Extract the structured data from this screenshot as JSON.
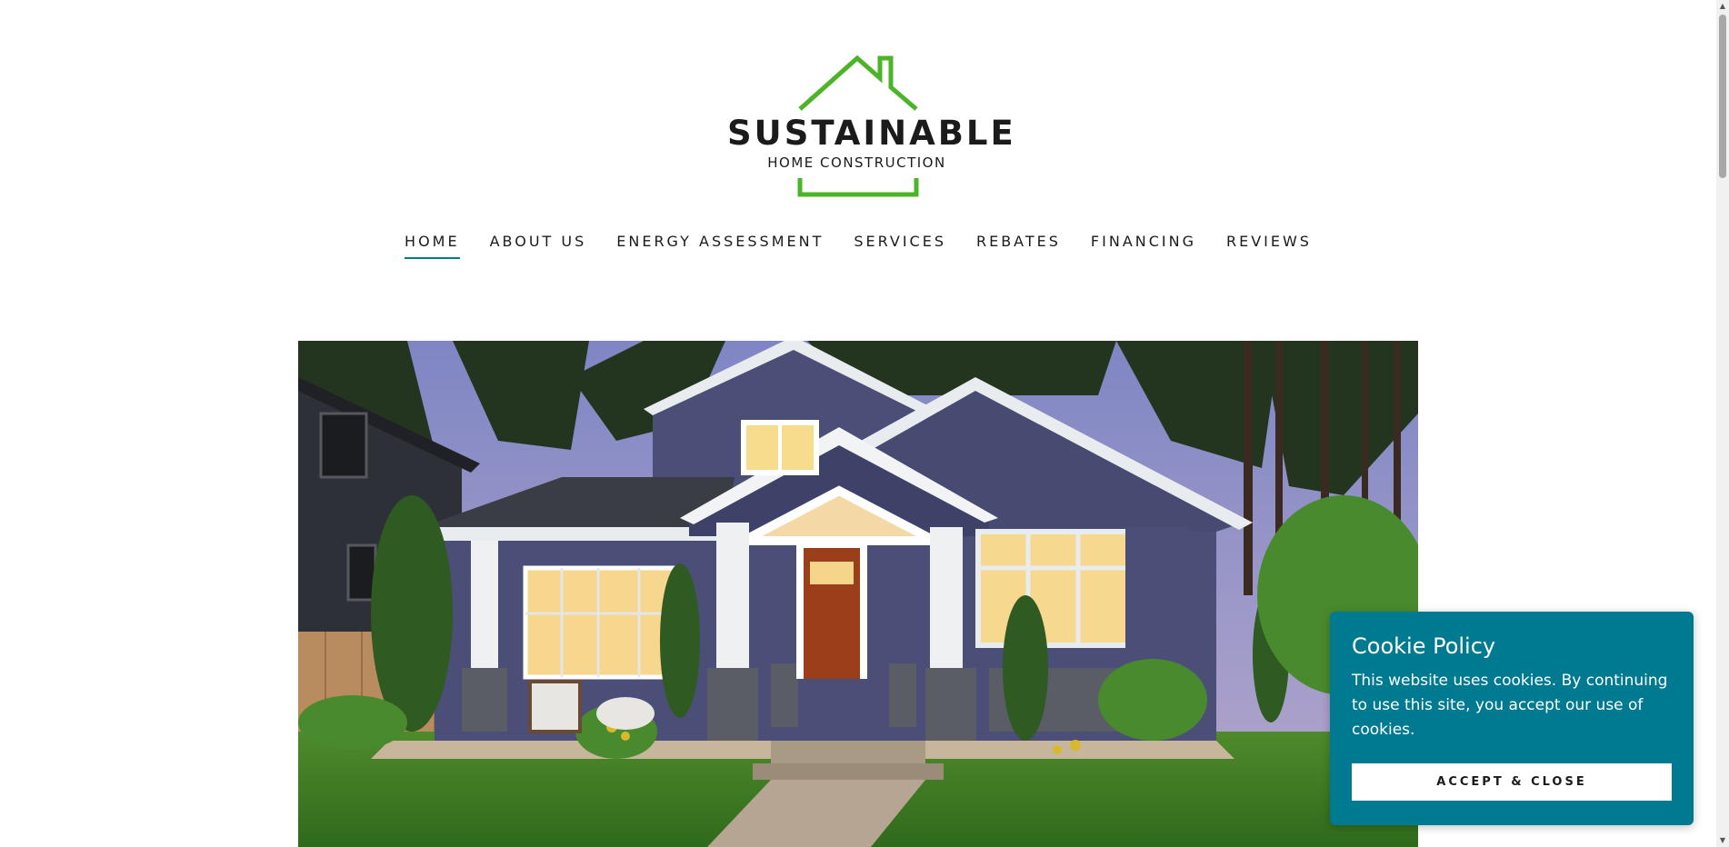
{
  "brand": {
    "name": "SUSTAINABLE",
    "tagline": "HOME CONSTRUCTION",
    "logo_icon": "house-outline-icon",
    "accent_color": "#4cb527"
  },
  "nav": {
    "items": [
      {
        "label": "HOME",
        "active": true
      },
      {
        "label": "ABOUT US",
        "active": false
      },
      {
        "label": "ENERGY ASSESSMENT",
        "active": false
      },
      {
        "label": "SERVICES",
        "active": false
      },
      {
        "label": "REBATES",
        "active": false
      },
      {
        "label": "FINANCING",
        "active": false
      },
      {
        "label": "REVIEWS",
        "active": false
      }
    ],
    "active_underline_color": "#007a91"
  },
  "hero": {
    "image_subject": "craftsman-house-photo"
  },
  "cookie_banner": {
    "title": "Cookie Policy",
    "text": "This website uses cookies. By continuing to use this site, you accept our use of cookies.",
    "button_label": "ACCEPT & CLOSE",
    "background_color": "#007a91"
  }
}
